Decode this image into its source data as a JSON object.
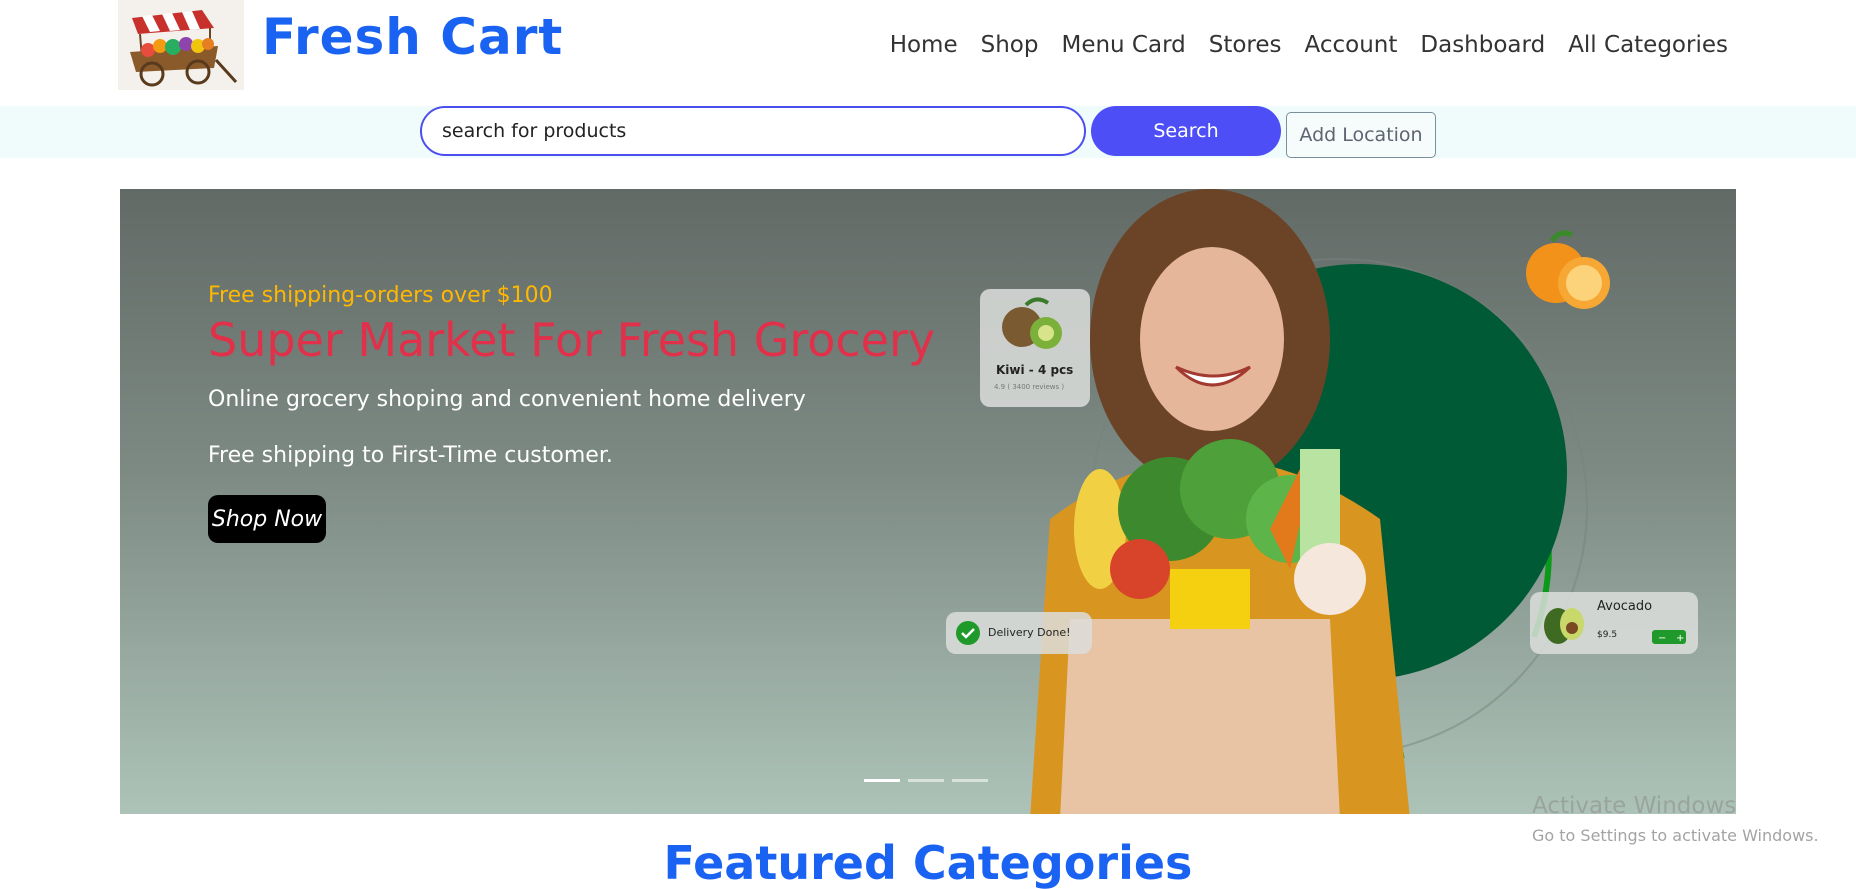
{
  "brand": {
    "name": "Fresh Cart"
  },
  "nav": {
    "items": [
      "Home",
      "Shop",
      "Menu Card",
      "Stores",
      "Account",
      "Dashboard",
      "All Categories"
    ]
  },
  "search": {
    "value": "search for products",
    "button_label": "Search",
    "location_label": "Add Location"
  },
  "hero": {
    "subtitle": "Free shipping-orders over $100",
    "title": "Super Market For Fresh Grocery",
    "line1": "Online grocery shoping and convenient home delivery",
    "line2": "Free shipping to First-Time customer.",
    "cta_label": "Shop Now",
    "cards": {
      "kiwi_title": "Kiwi - 4 pcs",
      "kiwi_rating": "4.9 ( 3400 reviews )",
      "delivery": "Delivery Done!",
      "avocado_title": "Avocado",
      "avocado_price": "$9.5"
    },
    "slides_total": 3,
    "active_slide": 1
  },
  "watermark": {
    "line1": "Activate Windows",
    "line2": "Go to Settings to activate Windows."
  },
  "sections": {
    "featured": "Featured Categories"
  },
  "colors": {
    "brand": "#1a63f2",
    "hero_title": "#e0304a",
    "hero_subtitle": "#ffb700",
    "search_button": "#4d4ef6"
  }
}
